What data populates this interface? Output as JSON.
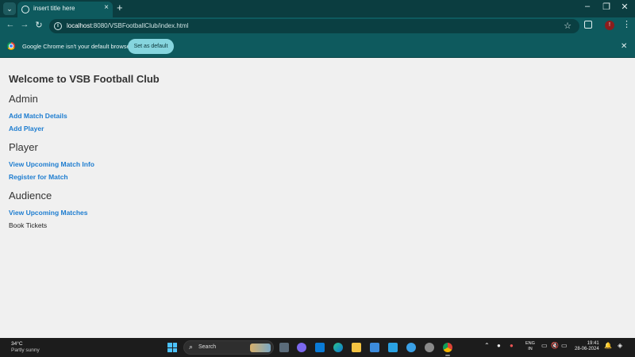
{
  "browser": {
    "tab": {
      "title": "insert title here",
      "close": "×"
    },
    "new_tab": "+",
    "window": {
      "minimize": "–",
      "maximize": "❐",
      "close": "✕"
    },
    "url": {
      "host": "localhost",
      "rest": ":8080/VSBFootballClub/index.html"
    },
    "infobar": {
      "message": "Google Chrome isn't your default browser",
      "button": "Set as default"
    },
    "profile_letter": "!"
  },
  "page": {
    "title": "Welcome to VSB Football Club",
    "sections": [
      {
        "heading": "Admin",
        "links": [
          "Add Match Details",
          "Add Player"
        ]
      },
      {
        "heading": "Player",
        "links": [
          "View Upcoming Match Info",
          "Register for Match"
        ]
      },
      {
        "heading": "Audience",
        "links": [
          "View Upcoming Matches"
        ],
        "plain": "Book Tickets"
      }
    ]
  },
  "taskbar": {
    "weather": {
      "temp": "34°C",
      "desc": "Partly sunny"
    },
    "search_label": "Search",
    "lang": [
      "ENG",
      "IN"
    ],
    "time": "19:41",
    "date": "28-06-2024"
  },
  "colors": {
    "chrome_teal": "#0e5a5e",
    "link": "#1e7dd0",
    "page_bg": "#f0f0f0"
  }
}
